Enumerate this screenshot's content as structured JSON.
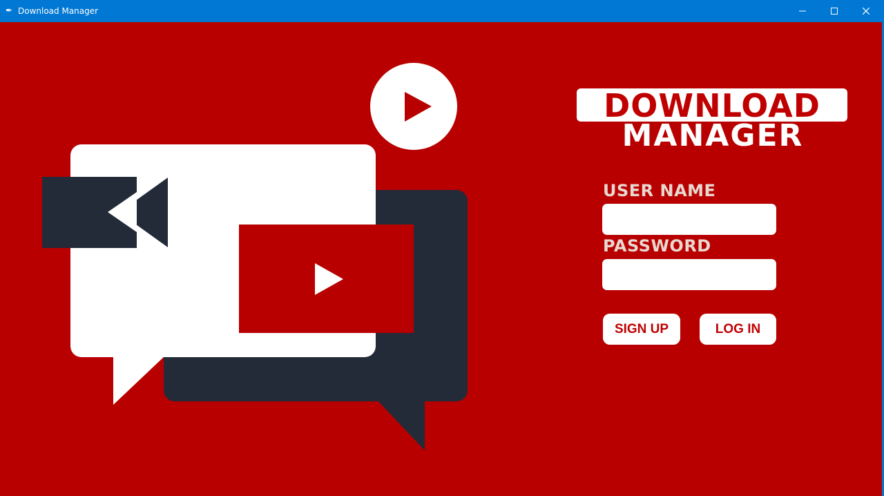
{
  "window": {
    "title": "Download Manager",
    "icon": "feather-icon",
    "controls": [
      "minimize-icon",
      "maximize-icon",
      "close-icon"
    ]
  },
  "logo": {
    "line1": "DOWNLOAD",
    "line2": "MANAGER"
  },
  "form": {
    "username_label": "USER NAME",
    "username_value": "",
    "password_label": "PASSWORD",
    "password_value": "",
    "signup_label": "SIGN UP",
    "login_label": "LOG IN"
  },
  "colors": {
    "background": "#b80000",
    "titlebar": "#0078d4",
    "dark_navy": "#232b39",
    "accent_red": "#c00000",
    "white": "#ffffff"
  }
}
